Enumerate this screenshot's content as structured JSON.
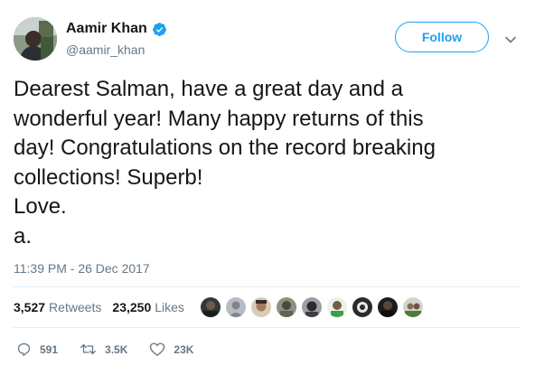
{
  "author": {
    "name": "Aamir Khan",
    "handle": "@aamir_khan",
    "verified_icon": "verified-badge-icon"
  },
  "follow_label": "Follow",
  "tweet": {
    "lines": [
      "Dearest Salman, have a great day and a",
      "wonderful year! Many happy returns of this",
      "day! Congratulations on the record breaking",
      "collections! Superb!",
      "Love.",
      "a."
    ]
  },
  "timestamp": "11:39 PM - 26 Dec 2017",
  "stats": {
    "retweets_count": "3,527",
    "retweets_label": "Retweets",
    "likes_count": "23,250",
    "likes_label": "Likes"
  },
  "actions": {
    "reply_count": "591",
    "retweet_count": "3.5K",
    "like_count": "23K"
  },
  "colors": {
    "accent": "#1da1f2",
    "muted": "#657786",
    "text": "#14171a",
    "divider": "#e6ecf0"
  }
}
